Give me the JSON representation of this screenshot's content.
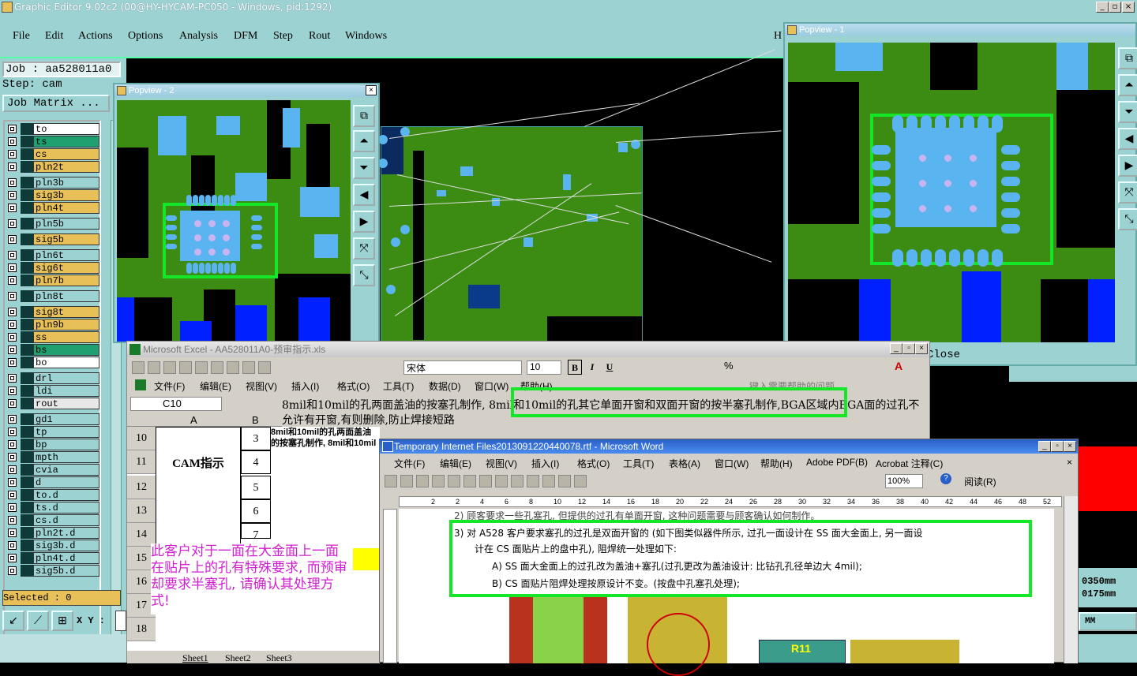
{
  "main_window": {
    "title": "Graphic Editor 9.02c2 (00@HY-HYCAM-PC050 - Windows, pid:1292)",
    "menu": [
      "File",
      "Edit",
      "Actions",
      "Options",
      "Analysis",
      "DFM",
      "Step",
      "Rout",
      "Windows"
    ],
    "menu_right": "H",
    "close_label": "Close"
  },
  "left_panel": {
    "job": "Job : aa528011a0",
    "step": "Step: cam",
    "job_matrix": "Job Matrix ...",
    "selected": "Selected : 0",
    "xy_label": "X Y :",
    "layers": [
      {
        "name": "to",
        "color": "#ffffff"
      },
      {
        "name": "ts",
        "color": "#20a070"
      },
      {
        "name": "cs",
        "color": "#e8c058"
      },
      {
        "name": "pln2t",
        "color": "#e8c058"
      },
      {
        "name": "pln3b",
        "color": "#9cd2d2"
      },
      {
        "name": "sig3b",
        "color": "#e8c058"
      },
      {
        "name": "pln4t",
        "color": "#e8c058"
      },
      {
        "name": "pln5b",
        "color": "#9cd2d2"
      },
      {
        "name": "sig5b",
        "color": "#e8c058"
      },
      {
        "name": "pln6t",
        "color": "#9cd2d2"
      },
      {
        "name": "sig6t",
        "color": "#e8c058"
      },
      {
        "name": "pln7b",
        "color": "#e8c058"
      },
      {
        "name": "pln8t",
        "color": "#9cd2d2"
      },
      {
        "name": "sig8t",
        "color": "#e8c058"
      },
      {
        "name": "pln9b",
        "color": "#e8c058"
      },
      {
        "name": "ss",
        "color": "#e8c058"
      },
      {
        "name": "bs",
        "color": "#20a070"
      },
      {
        "name": "bo",
        "color": "#ffffff"
      },
      {
        "name": "drl",
        "color": "#9cd2d2"
      },
      {
        "name": "ldi",
        "color": "#9cd2d2"
      },
      {
        "name": "rout",
        "color": "#e8e8e8"
      },
      {
        "name": "gd1",
        "color": "#9cd2d2"
      },
      {
        "name": "tp",
        "color": "#9cd2d2"
      },
      {
        "name": "bp",
        "color": "#9cd2d2"
      },
      {
        "name": "mpth",
        "color": "#9cd2d2"
      },
      {
        "name": "cvia",
        "color": "#9cd2d2"
      },
      {
        "name": "d",
        "color": "#9cd2d2"
      },
      {
        "name": "to.d",
        "color": "#9cd2d2"
      },
      {
        "name": "ts.d",
        "color": "#9cd2d2"
      },
      {
        "name": "cs.d",
        "color": "#9cd2d2"
      },
      {
        "name": "pln2t.d",
        "color": "#9cd2d2"
      },
      {
        "name": "sig3b.d",
        "color": "#9cd2d2"
      },
      {
        "name": "pln4t.d",
        "color": "#9cd2d2"
      },
      {
        "name": "sig5b.d",
        "color": "#9cd2d2"
      }
    ]
  },
  "popview2": {
    "title": "Popview - 2"
  },
  "popview1": {
    "title": "Popview - 1"
  },
  "excel": {
    "title": "Microsoft Excel - AA528011A0-预审指示.xls",
    "menu": [
      "文件(F)",
      "编辑(E)",
      "视图(V)",
      "插入(I)",
      "格式(O)",
      "工具(T)",
      "数据(D)",
      "窗口(W)",
      "帮助(H)"
    ],
    "help_box": "键入需要帮助的问题",
    "font_name": "宋体",
    "font_size": "10",
    "cell_ref": "C10",
    "formula_text": "8mil和10mil的孔两面盖油的按塞孔制作, 8mil和10mil的孔其它单面开窗和双面开窗的按半塞孔制作,BGA区域内BGA面的过孔不允许有开窗,有则删除,防止焊接短路",
    "col_headers": [
      "A",
      "B"
    ],
    "rows": [
      "10",
      "11",
      "12",
      "13",
      "14",
      "15",
      "16",
      "17",
      "18"
    ],
    "b_values": [
      "3",
      "4",
      "5",
      "6",
      "7"
    ],
    "cam_label": "CAM指示",
    "c10_text": "8mil和10mil的孔两面盖油的按塞孔制作, 8mil和10mil的孔其它单面开窗和双面开窗的按半塞孔制作,BGA区域内BGA面的",
    "note": "此客户对于一面在大金面上一面在贴片上的孔有特殊要求, 而预审却要求半塞孔, 请确认其处理方式!",
    "sheets": [
      "Sheet1",
      "Sheet2",
      "Sheet3"
    ]
  },
  "word": {
    "title": "Temporary Internet Files2013091220440078.rtf - Microsoft Word",
    "menu": [
      "文件(F)",
      "编辑(E)",
      "视图(V)",
      "插入(I)",
      "格式(O)",
      "工具(T)",
      "表格(A)",
      "窗口(W)",
      "帮助(H)",
      "Adobe PDF(B)",
      "Acrobat 注释(C)"
    ],
    "zoom": "100%",
    "read_label": "阅读(R)",
    "ruler": [
      "2",
      "2",
      "4",
      "6",
      "8",
      "10",
      "12",
      "14",
      "16",
      "18",
      "20",
      "22",
      "24",
      "26",
      "28",
      "30",
      "32",
      "34",
      "36",
      "38",
      "40",
      "42",
      "44",
      "46",
      "48",
      "52"
    ],
    "line0": "2) 顾客要求一些孔塞孔, 但提供的过孔有单面开窗, 这种问题需要与顾客确认如何制作。",
    "line1": "3) 对 A528 客户要求塞孔的过孔是双面开窗的 (如下图类似器件所示, 过孔一面设计在 SS 面大金面上, 另一面设",
    "line2": "计在 CS 面贴片上的盘中孔), 阻焊统一处理如下:",
    "line3": "A) SS 面大金面上的过孔改为盖油+塞孔(过孔更改为盖油设计: 比钻孔孔径单边大 4mil);",
    "line4": "B) CS 面贴片阻焊处理按原设计不变。(按盘中孔塞孔处理);",
    "fig_label": "R11"
  },
  "right_bottom": {
    "coord1": "0350mm",
    "coord2": "0175mm",
    "units": "MM"
  }
}
